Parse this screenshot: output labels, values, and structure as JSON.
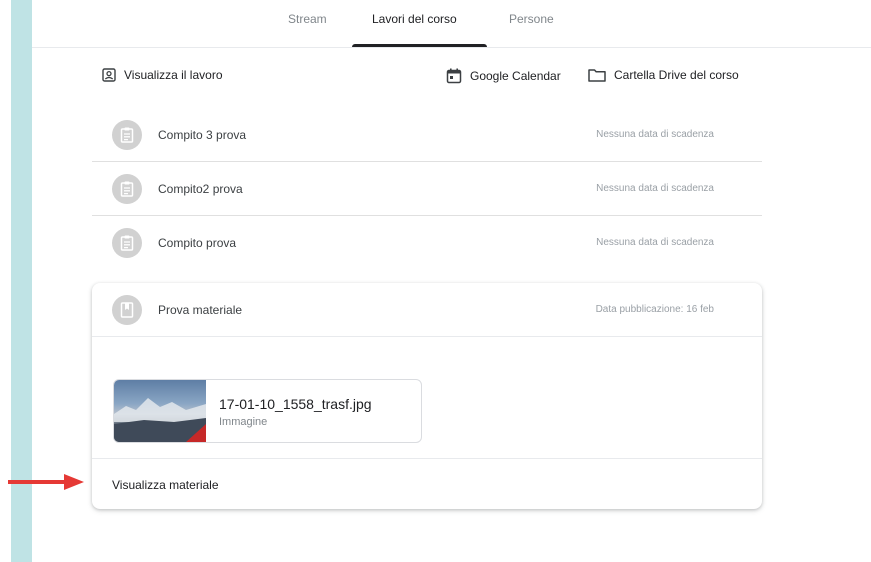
{
  "tabs": [
    {
      "label": "Stream",
      "active": false
    },
    {
      "label": "Lavori del corso",
      "active": true
    },
    {
      "label": "Persone",
      "active": false
    }
  ],
  "toolbar": {
    "view_work": "Visualizza il lavoro",
    "google_calendar": "Google Calendar",
    "drive_folder": "Cartella Drive del corso"
  },
  "assignments": [
    {
      "title": "Compito 3 prova",
      "due": "Nessuna data di scadenza",
      "icon": "assignment-icon"
    },
    {
      "title": "Compito2 prova",
      "due": "Nessuna data di scadenza",
      "icon": "assignment-icon"
    },
    {
      "title": "Compito prova",
      "due": "Nessuna data di scadenza",
      "icon": "assignment-icon"
    }
  ],
  "material": {
    "title": "Prova materiale",
    "published": "Data pubblicazione: 16 feb",
    "icon": "material-icon",
    "attachment": {
      "name": "17-01-10_1558_trasf.jpg",
      "type": "Immagine"
    },
    "view_label": "Visualizza materiale"
  },
  "colors": {
    "accent_strip": "#bfe3e5",
    "annotation_arrow": "#e53935",
    "active_tab": "#202124"
  }
}
